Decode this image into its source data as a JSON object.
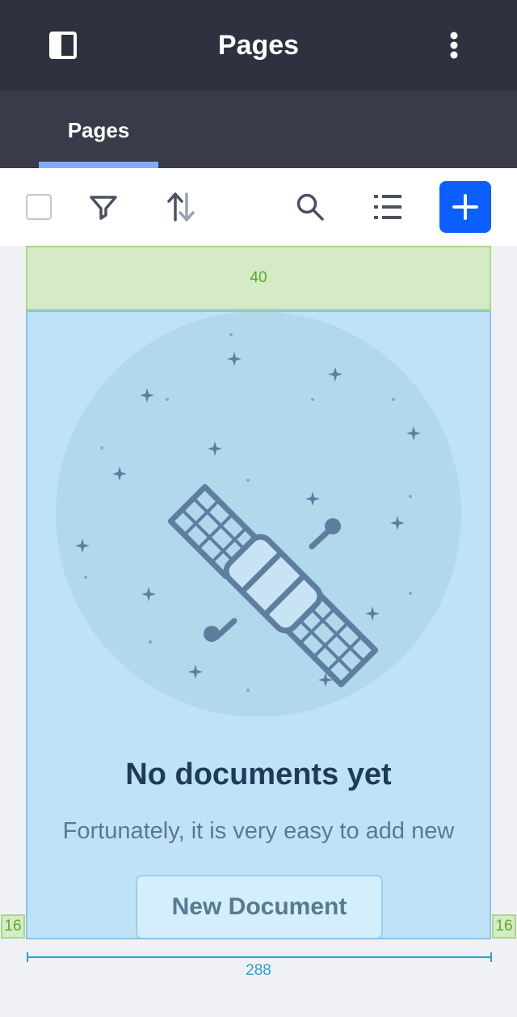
{
  "header": {
    "title": "Pages",
    "left_icon": "sidebar-toggle-icon",
    "right_icon": "kebab-menu-icon"
  },
  "tabs": [
    {
      "label": "Pages",
      "active": true
    }
  ],
  "toolbar": {
    "icons": [
      "checkbox",
      "filter-icon",
      "sort-icon",
      "search-icon",
      "list-view-icon",
      "plus-icon"
    ]
  },
  "layout_annotations": {
    "top_spacing": "40",
    "left_padding": "16",
    "right_padding": "16",
    "content_width": "288"
  },
  "empty_state": {
    "title": "No documents yet",
    "description": "Fortunately, it is very easy to add new",
    "button_label": "New Document",
    "illustration": "satellite-illustration"
  },
  "colors": {
    "header_bg": "#2f3140",
    "tabbar_bg": "#393a4a",
    "tab_indicator": "#80acff",
    "primary": "#0b5fff",
    "empty_area_bg": "#c0e2f6",
    "spacing_marker": "#d4ebc6"
  }
}
